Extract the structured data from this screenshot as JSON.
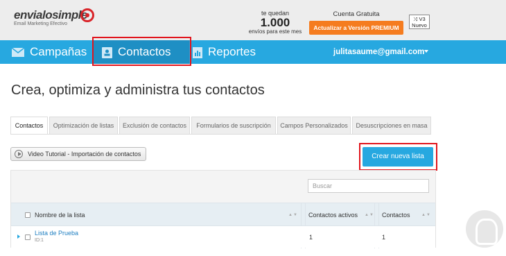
{
  "header": {
    "logo_text": "envialosimple",
    "logo_sub": "Email Marketing Efectivo",
    "quota_label": "te quedan",
    "quota_value": "1.000",
    "quota_unit": "envíos para este mes",
    "plan_label": "Cuenta Gratuita",
    "upgrade_label": "Actualizar a Versión PREMIUM",
    "version_label": "V3",
    "version_sub": "Nuevo"
  },
  "nav": {
    "items": [
      {
        "label": "Campañas"
      },
      {
        "label": "Contactos"
      },
      {
        "label": "Reportes"
      }
    ],
    "user": "julitasaume@gmail.com"
  },
  "page": {
    "title": "Crea, optimiza y administra tus contactos"
  },
  "tabs": [
    {
      "label": "Contactos"
    },
    {
      "label": "Optimización de listas"
    },
    {
      "label": "Exclusión de contactos"
    },
    {
      "label": "Formularios de suscripción"
    },
    {
      "label": "Campos Personalizados"
    },
    {
      "label": "Desuscripciones en masa"
    }
  ],
  "actions": {
    "video_label": "Video Tutorial - Importación de contactos",
    "new_list_label": "Crear nueva lista"
  },
  "table": {
    "search_placeholder": "Buscar",
    "columns": [
      "Nombre de la lista",
      "Contactos activos",
      "Contactos"
    ],
    "rows": [
      {
        "name": "Lista de Prueba",
        "id": "ID:1",
        "active": "1",
        "total": "1"
      }
    ]
  },
  "colors": {
    "nav_blue": "#27a8e0",
    "upgrade_orange": "#f57c1f",
    "highlight_red": "#e1141c"
  }
}
